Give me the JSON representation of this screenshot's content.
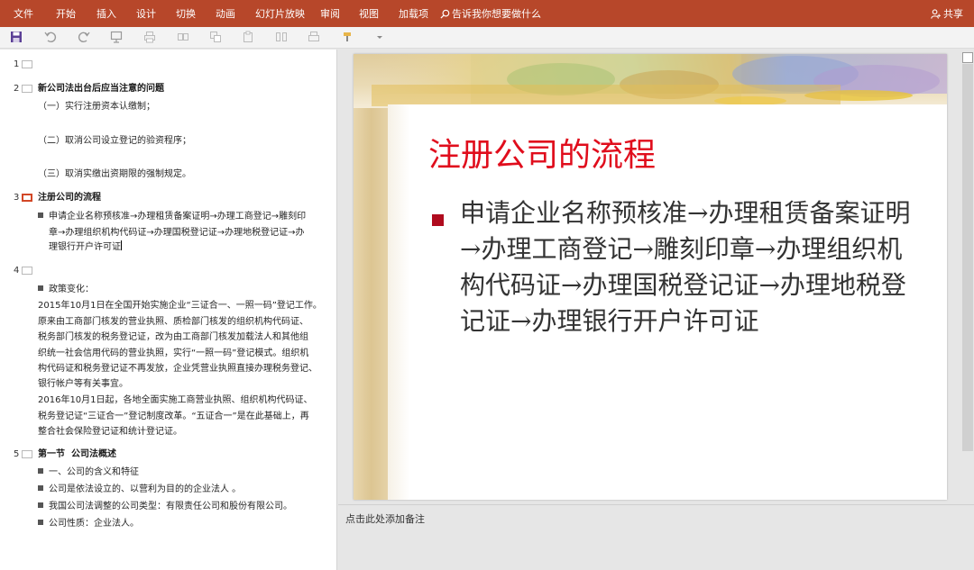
{
  "ribbon": {
    "tabs": [
      "文件",
      "开始",
      "插入",
      "设计",
      "切换",
      "动画",
      "幻灯片放映",
      "审阅",
      "视图",
      "加载项"
    ],
    "tell_me": "告诉我你想要做什么",
    "share": "共享"
  },
  "outline": {
    "slides": [
      {
        "num": "1",
        "title": ""
      },
      {
        "num": "2",
        "title": "新公司法出台后应当注意的问题",
        "lines": [
          "（一）实行注册资本认缴制；",
          "（二）取消公司设立登记的验资程序；",
          "（三）取消实缴出资期限的强制规定。"
        ]
      },
      {
        "num": "3",
        "title": "注册公司的流程",
        "bullet_lines": [
          "申请企业名称预核准→办理租赁备案证明→办理工商登记→雕刻印",
          "章→办理组织机构代码证→办理国税登记证→办理地税登记证→办",
          "理银行开户许可证"
        ]
      },
      {
        "num": "4",
        "title": "",
        "bullet": "政策变化：",
        "para1": [
          "2015年10月1日在全国开始实施企业“三证合一、一照一码”登记工作。",
          "原来由工商部门核发的营业执照、质检部门核发的组织机构代码证、",
          "税务部门核发的税务登记证，改为由工商部门核发加载法人和其他组",
          "织统一社会信用代码的营业执照，实行“一照一码”登记模式。组织机",
          "构代码证和税务登记证不再发放，企业凭营业执照直接办理税务登记、",
          "银行帐户等有关事宜。"
        ],
        "para2": [
          "2016年10月1日起，各地全面实施工商营业执照、组织机构代码证、",
          "税务登记证“三证合一”登记制度改革。“五证合一”是在此基础上，再",
          "整合社会保险登记证和统计登记证。"
        ]
      },
      {
        "num": "5",
        "title": "第一节  公司法概述",
        "bullets": [
          "一、公司的含义和特征",
          "公司是依法设立的、以营利为目的的企业法人 。",
          "我国公司法调整的公司类型：有限责任公司和股份有限公司。",
          "公司性质：企业法人。"
        ]
      }
    ]
  },
  "slide": {
    "title": "注册公司的流程",
    "body": "申请企业名称预核准→办理租赁备案证明→办理工商登记→雕刻印章→办理组织机构代码证→办理国税登记证→办理地税登记证→办理银行开户许可证"
  },
  "notes": {
    "placeholder": "点击此处添加备注"
  },
  "colors": {
    "ribbon": "#b7472a",
    "title_red": "#e00d1c",
    "bullet_red": "#b00b1e",
    "selected_outline": "#d24726"
  }
}
